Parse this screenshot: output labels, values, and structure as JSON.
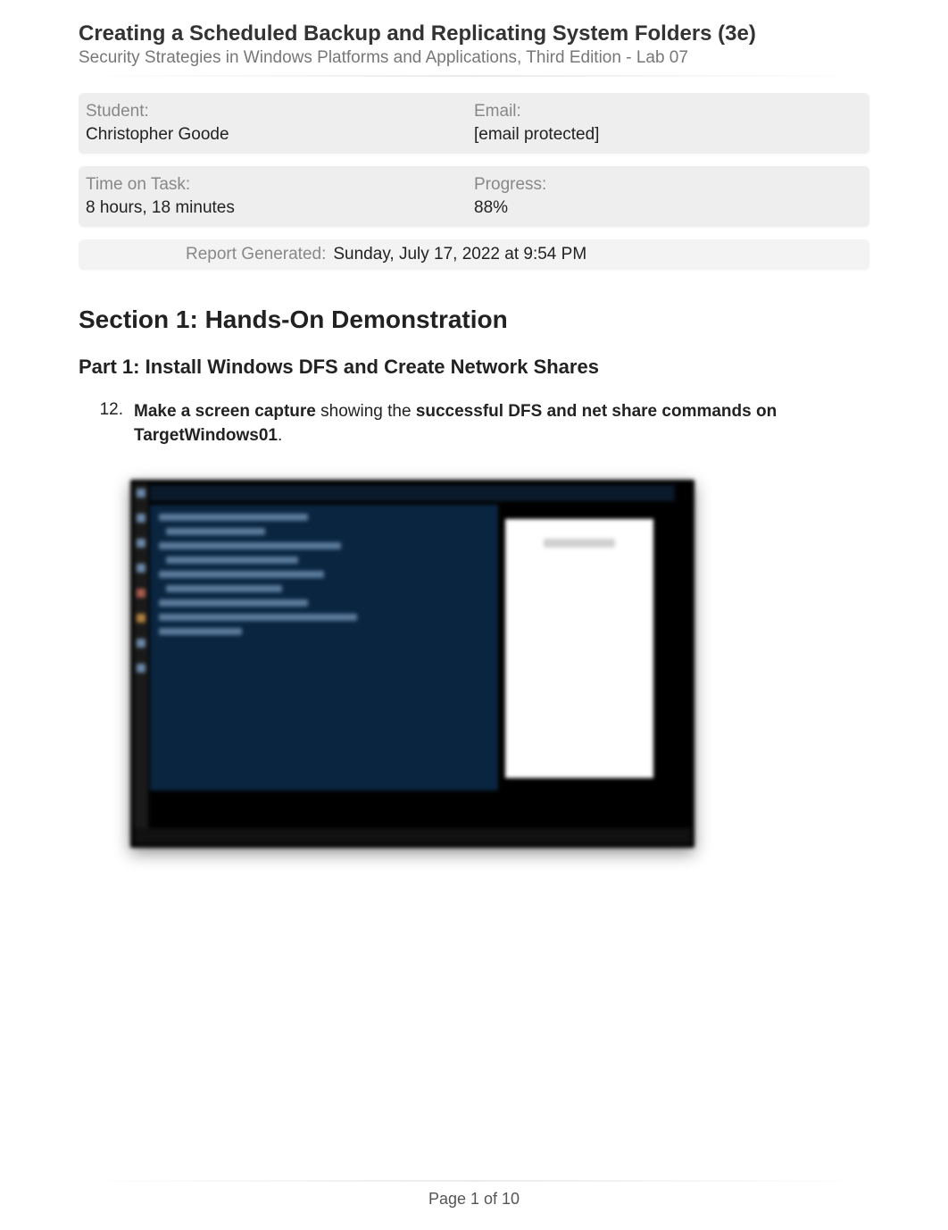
{
  "header": {
    "title": "Creating a Scheduled Backup and Replicating System Folders (3e)",
    "subtitle": "Security Strategies in Windows Platforms and Applications, Third Edition - Lab 07"
  },
  "info": {
    "student_label": "Student:",
    "student_value": "Christopher Goode",
    "email_label": "Email:",
    "email_value": "[email protected]",
    "time_label": "Time on Task:",
    "time_value": "8 hours, 18 minutes",
    "progress_label": "Progress:",
    "progress_value": "88%"
  },
  "report": {
    "generated_label": "Report Generated:",
    "generated_value": "Sunday, July 17, 2022 at 9:54 PM"
  },
  "section": {
    "title": "Section 1: Hands-On Demonstration",
    "part_title": "Part 1: Install Windows DFS and Create Network Shares",
    "item_number": "12.",
    "instruction_bold1": "Make a screen capture",
    "instruction_mid": " showing the ",
    "instruction_bold2": "successful DFS and net share commands on TargetWindows01",
    "instruction_end": "."
  },
  "footer": {
    "page_text": "Page 1 of 10"
  }
}
